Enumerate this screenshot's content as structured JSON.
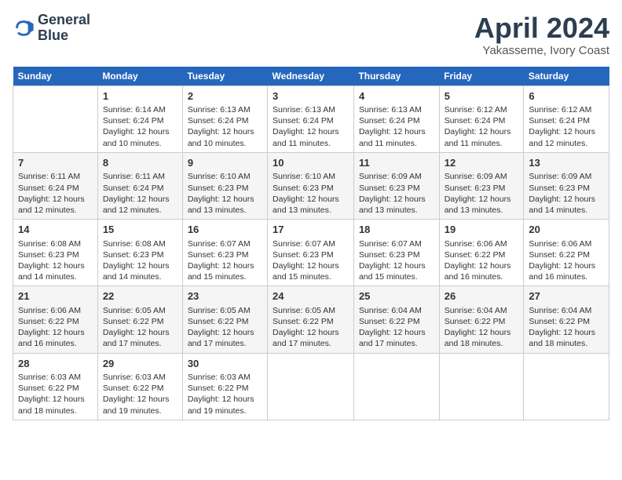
{
  "header": {
    "logo_line1": "General",
    "logo_line2": "Blue",
    "month_title": "April 2024",
    "location": "Yakasseme, Ivory Coast"
  },
  "days_of_week": [
    "Sunday",
    "Monday",
    "Tuesday",
    "Wednesday",
    "Thursday",
    "Friday",
    "Saturday"
  ],
  "weeks": [
    [
      {
        "day": "",
        "sunrise": "",
        "sunset": "",
        "daylight": ""
      },
      {
        "day": "1",
        "sunrise": "Sunrise: 6:14 AM",
        "sunset": "Sunset: 6:24 PM",
        "daylight": "Daylight: 12 hours and 10 minutes."
      },
      {
        "day": "2",
        "sunrise": "Sunrise: 6:13 AM",
        "sunset": "Sunset: 6:24 PM",
        "daylight": "Daylight: 12 hours and 10 minutes."
      },
      {
        "day": "3",
        "sunrise": "Sunrise: 6:13 AM",
        "sunset": "Sunset: 6:24 PM",
        "daylight": "Daylight: 12 hours and 11 minutes."
      },
      {
        "day": "4",
        "sunrise": "Sunrise: 6:13 AM",
        "sunset": "Sunset: 6:24 PM",
        "daylight": "Daylight: 12 hours and 11 minutes."
      },
      {
        "day": "5",
        "sunrise": "Sunrise: 6:12 AM",
        "sunset": "Sunset: 6:24 PM",
        "daylight": "Daylight: 12 hours and 11 minutes."
      },
      {
        "day": "6",
        "sunrise": "Sunrise: 6:12 AM",
        "sunset": "Sunset: 6:24 PM",
        "daylight": "Daylight: 12 hours and 12 minutes."
      }
    ],
    [
      {
        "day": "7",
        "sunrise": "Sunrise: 6:11 AM",
        "sunset": "Sunset: 6:24 PM",
        "daylight": "Daylight: 12 hours and 12 minutes."
      },
      {
        "day": "8",
        "sunrise": "Sunrise: 6:11 AM",
        "sunset": "Sunset: 6:24 PM",
        "daylight": "Daylight: 12 hours and 12 minutes."
      },
      {
        "day": "9",
        "sunrise": "Sunrise: 6:10 AM",
        "sunset": "Sunset: 6:23 PM",
        "daylight": "Daylight: 12 hours and 13 minutes."
      },
      {
        "day": "10",
        "sunrise": "Sunrise: 6:10 AM",
        "sunset": "Sunset: 6:23 PM",
        "daylight": "Daylight: 12 hours and 13 minutes."
      },
      {
        "day": "11",
        "sunrise": "Sunrise: 6:09 AM",
        "sunset": "Sunset: 6:23 PM",
        "daylight": "Daylight: 12 hours and 13 minutes."
      },
      {
        "day": "12",
        "sunrise": "Sunrise: 6:09 AM",
        "sunset": "Sunset: 6:23 PM",
        "daylight": "Daylight: 12 hours and 13 minutes."
      },
      {
        "day": "13",
        "sunrise": "Sunrise: 6:09 AM",
        "sunset": "Sunset: 6:23 PM",
        "daylight": "Daylight: 12 hours and 14 minutes."
      }
    ],
    [
      {
        "day": "14",
        "sunrise": "Sunrise: 6:08 AM",
        "sunset": "Sunset: 6:23 PM",
        "daylight": "Daylight: 12 hours and 14 minutes."
      },
      {
        "day": "15",
        "sunrise": "Sunrise: 6:08 AM",
        "sunset": "Sunset: 6:23 PM",
        "daylight": "Daylight: 12 hours and 14 minutes."
      },
      {
        "day": "16",
        "sunrise": "Sunrise: 6:07 AM",
        "sunset": "Sunset: 6:23 PM",
        "daylight": "Daylight: 12 hours and 15 minutes."
      },
      {
        "day": "17",
        "sunrise": "Sunrise: 6:07 AM",
        "sunset": "Sunset: 6:23 PM",
        "daylight": "Daylight: 12 hours and 15 minutes."
      },
      {
        "day": "18",
        "sunrise": "Sunrise: 6:07 AM",
        "sunset": "Sunset: 6:23 PM",
        "daylight": "Daylight: 12 hours and 15 minutes."
      },
      {
        "day": "19",
        "sunrise": "Sunrise: 6:06 AM",
        "sunset": "Sunset: 6:22 PM",
        "daylight": "Daylight: 12 hours and 16 minutes."
      },
      {
        "day": "20",
        "sunrise": "Sunrise: 6:06 AM",
        "sunset": "Sunset: 6:22 PM",
        "daylight": "Daylight: 12 hours and 16 minutes."
      }
    ],
    [
      {
        "day": "21",
        "sunrise": "Sunrise: 6:06 AM",
        "sunset": "Sunset: 6:22 PM",
        "daylight": "Daylight: 12 hours and 16 minutes."
      },
      {
        "day": "22",
        "sunrise": "Sunrise: 6:05 AM",
        "sunset": "Sunset: 6:22 PM",
        "daylight": "Daylight: 12 hours and 17 minutes."
      },
      {
        "day": "23",
        "sunrise": "Sunrise: 6:05 AM",
        "sunset": "Sunset: 6:22 PM",
        "daylight": "Daylight: 12 hours and 17 minutes."
      },
      {
        "day": "24",
        "sunrise": "Sunrise: 6:05 AM",
        "sunset": "Sunset: 6:22 PM",
        "daylight": "Daylight: 12 hours and 17 minutes."
      },
      {
        "day": "25",
        "sunrise": "Sunrise: 6:04 AM",
        "sunset": "Sunset: 6:22 PM",
        "daylight": "Daylight: 12 hours and 17 minutes."
      },
      {
        "day": "26",
        "sunrise": "Sunrise: 6:04 AM",
        "sunset": "Sunset: 6:22 PM",
        "daylight": "Daylight: 12 hours and 18 minutes."
      },
      {
        "day": "27",
        "sunrise": "Sunrise: 6:04 AM",
        "sunset": "Sunset: 6:22 PM",
        "daylight": "Daylight: 12 hours and 18 minutes."
      }
    ],
    [
      {
        "day": "28",
        "sunrise": "Sunrise: 6:03 AM",
        "sunset": "Sunset: 6:22 PM",
        "daylight": "Daylight: 12 hours and 18 minutes."
      },
      {
        "day": "29",
        "sunrise": "Sunrise: 6:03 AM",
        "sunset": "Sunset: 6:22 PM",
        "daylight": "Daylight: 12 hours and 19 minutes."
      },
      {
        "day": "30",
        "sunrise": "Sunrise: 6:03 AM",
        "sunset": "Sunset: 6:22 PM",
        "daylight": "Daylight: 12 hours and 19 minutes."
      },
      {
        "day": "",
        "sunrise": "",
        "sunset": "",
        "daylight": ""
      },
      {
        "day": "",
        "sunrise": "",
        "sunset": "",
        "daylight": ""
      },
      {
        "day": "",
        "sunrise": "",
        "sunset": "",
        "daylight": ""
      },
      {
        "day": "",
        "sunrise": "",
        "sunset": "",
        "daylight": ""
      }
    ]
  ]
}
